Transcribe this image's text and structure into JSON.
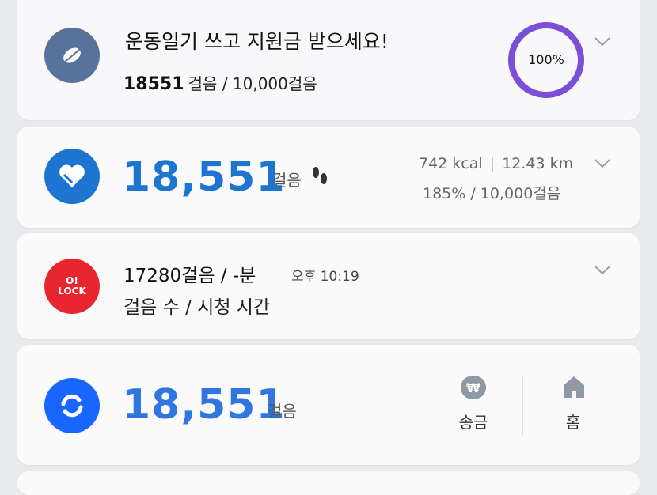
{
  "widgets": [
    {
      "title": "운동일기 쓰고 지원금 받으세요!",
      "steps": "18551",
      "steps_suffix": "걸음 / 10,000걸음",
      "progress_label": "100%",
      "progress": 1.0,
      "colors": {
        "icon_bg": "#58739b",
        "ring": "#7b4fd6"
      }
    },
    {
      "steps": "18,551",
      "steps_unit": "걸음",
      "kcal": "742 kcal",
      "km": "12.43 km",
      "percent_goal": "185% / 10,000걸음",
      "colors": {
        "icon_bg": "#1e74d1",
        "accent": "#1e74d1"
      }
    },
    {
      "title": "17280걸음 / -분",
      "time": "오후 10:19",
      "subtitle": "걸음 수 / 시청 시간",
      "icon_text_top": "O!",
      "icon_text_bottom": "LOCK",
      "colors": {
        "icon_bg": "#e8262f"
      }
    },
    {
      "steps": "18,551",
      "steps_unit": "걸음",
      "actions": [
        {
          "label": "송금",
          "icon": "won-bubble-icon"
        },
        {
          "label": "홈",
          "icon": "home-icon"
        }
      ],
      "colors": {
        "icon_bg": "#1766ff",
        "accent": "#2f76e0"
      }
    }
  ]
}
